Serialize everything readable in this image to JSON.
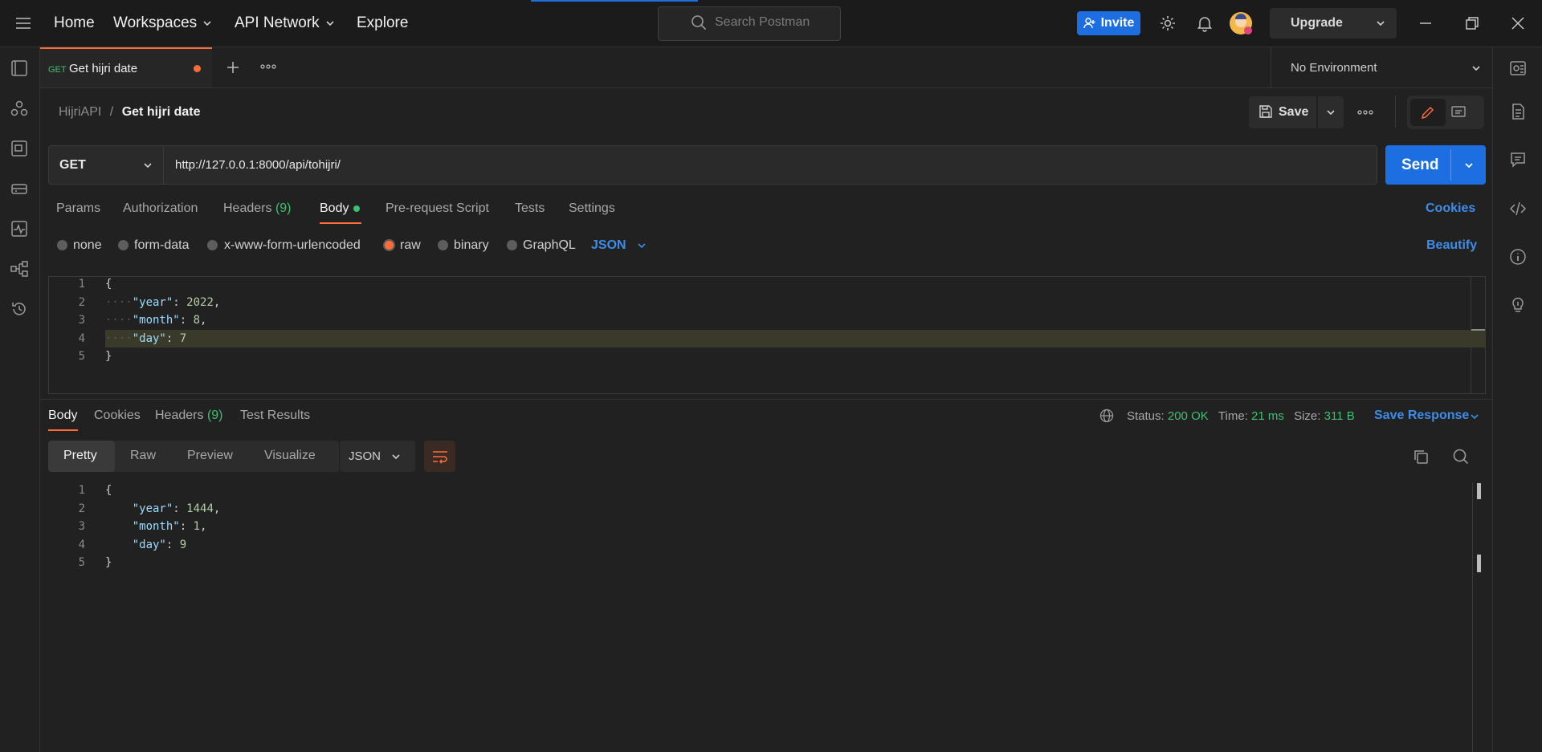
{
  "topbar": {
    "home": "Home",
    "workspaces": "Workspaces",
    "api_network": "API Network",
    "explore": "Explore",
    "search_placeholder": "Search Postman",
    "invite": "Invite",
    "upgrade": "Upgrade"
  },
  "tab": {
    "method": "GET",
    "name": "Get hijri date",
    "environment": "No Environment"
  },
  "breadcrumb": {
    "collection": "HijriAPI",
    "separator": "/",
    "request": "Get hijri date"
  },
  "actions": {
    "save": "Save"
  },
  "request": {
    "method": "GET",
    "url": "http://127.0.0.1:8000/api/tohijri/",
    "send": "Send"
  },
  "req_tabs": {
    "params": "Params",
    "authorization": "Authorization",
    "headers": "Headers",
    "headers_count": "(9)",
    "body": "Body",
    "prerequest": "Pre-request Script",
    "tests": "Tests",
    "settings": "Settings",
    "cookies": "Cookies"
  },
  "body_types": {
    "none": "none",
    "form_data": "form-data",
    "urlencoded": "x-www-form-urlencoded",
    "raw": "raw",
    "binary": "binary",
    "graphql": "GraphQL",
    "format": "JSON",
    "beautify": "Beautify"
  },
  "request_body": {
    "line_numbers": [
      "1",
      "2",
      "3",
      "4",
      "5"
    ],
    "open": "{",
    "close": "}",
    "k1": "\"year\"",
    "v1": "2022",
    "k2": "\"month\"",
    "v2": "8",
    "k3": "\"day\"",
    "v3": "7",
    "colon": ": ",
    "comma": ","
  },
  "response": {
    "tabs": {
      "body": "Body",
      "cookies": "Cookies",
      "headers": "Headers",
      "headers_count": "(9)",
      "test_results": "Test Results"
    },
    "status_label": "Status:",
    "status_value": "200 OK",
    "time_label": "Time:",
    "time_value": "21 ms",
    "size_label": "Size:",
    "size_value": "311 B",
    "save_response": "Save Response",
    "views": {
      "pretty": "Pretty",
      "raw": "Raw",
      "preview": "Preview",
      "visualize": "Visualize"
    },
    "format": "JSON",
    "body": {
      "line_numbers": [
        "1",
        "2",
        "3",
        "4",
        "5"
      ],
      "open": "{",
      "close": "}",
      "k1": "\"year\"",
      "v1": "1444",
      "k2": "\"month\"",
      "v2": "1",
      "k3": "\"day\"",
      "v3": "9"
    }
  },
  "colors": {
    "accent_orange": "#ff6c37",
    "primary_blue": "#1d6fe1",
    "link_blue": "#3d8ce8",
    "status_green": "#3fbf72",
    "get_green": "#3fbf72"
  }
}
